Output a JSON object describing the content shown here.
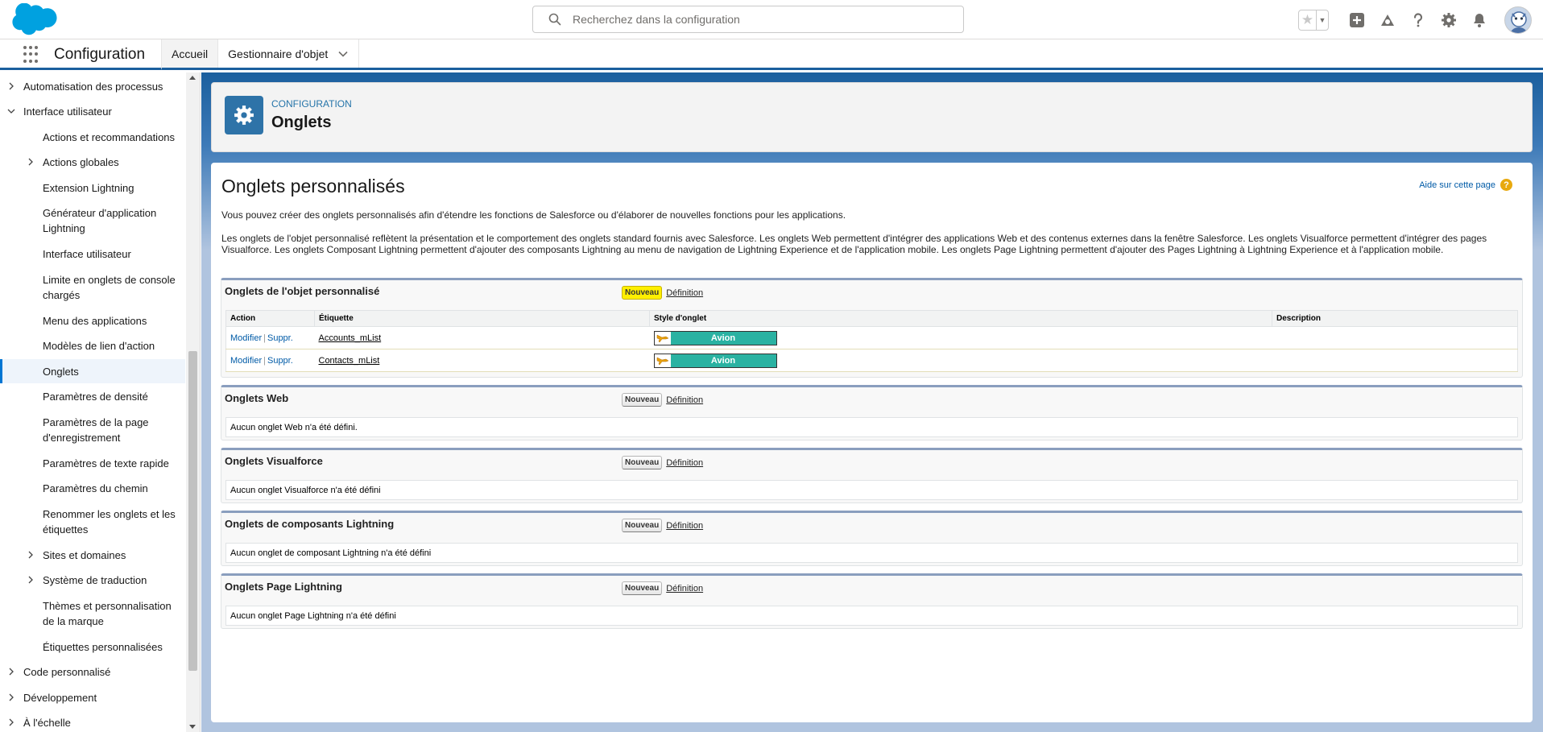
{
  "header": {
    "search_placeholder": "Recherchez dans la configuration"
  },
  "app_nav": {
    "app_name": "Configuration",
    "tabs": [
      {
        "label": "Accueil"
      },
      {
        "label": "Gestionnaire d'objet"
      }
    ]
  },
  "sidebar": {
    "items": [
      {
        "label": "Automatisation des processus"
      },
      {
        "label": "Interface utilisateur"
      },
      {
        "label": "Actions et recommandations"
      },
      {
        "label": "Actions globales"
      },
      {
        "label": "Extension Lightning"
      },
      {
        "label": "Générateur d'application Lightning"
      },
      {
        "label": "Interface utilisateur"
      },
      {
        "label": "Limite en onglets de console chargés"
      },
      {
        "label": "Menu des applications"
      },
      {
        "label": "Modèles de lien d'action"
      },
      {
        "label": "Onglets"
      },
      {
        "label": "Paramètres de densité"
      },
      {
        "label": "Paramètres de la page d'enregistrement"
      },
      {
        "label": "Paramètres de texte rapide"
      },
      {
        "label": "Paramètres du chemin"
      },
      {
        "label": "Renommer les onglets et les étiquettes"
      },
      {
        "label": "Sites et domaines"
      },
      {
        "label": "Système de traduction"
      },
      {
        "label": "Thèmes et personnalisation de la marque"
      },
      {
        "label": "Étiquettes personnalisées"
      },
      {
        "label": "Code personnalisé"
      },
      {
        "label": "Développement"
      },
      {
        "label": "À l'échelle"
      }
    ]
  },
  "page_header": {
    "kicker": "CONFIGURATION",
    "title": "Onglets"
  },
  "content": {
    "title": "Onglets personnalisés",
    "help_link": "Aide sur cette page",
    "para1": "Vous pouvez créer des onglets personnalisés afin d'étendre les fonctions de Salesforce ou d'élaborer de nouvelles fonctions pour les applications.",
    "para2": "Les onglets de l'objet personnalisé reflètent la présentation et le comportement des onglets standard fournis avec Salesforce. Les onglets Web permettent d'intégrer des applications Web et des contenus externes dans la fenêtre Salesforce. Les onglets Visualforce permettent d'intégrer des pages Visualforce. Les onglets Composant Lightning permettent d'ajouter des composants Lightning au menu de navigation de Lightning Experience et de l'application mobile. Les onglets Page Lightning permettent d'ajouter des Pages Lightning à Lightning Experience et à l'application mobile."
  },
  "sections": {
    "object": {
      "title": "Onglets de l'objet personnalisé",
      "new_label": "Nouveau",
      "def_label": "Définition",
      "columns": [
        "Action",
        "Étiquette",
        "Style d'onglet",
        "Description"
      ],
      "rows": [
        {
          "edit": "Modifier",
          "sep": "|",
          "del": "Suppr.",
          "label": "Accounts_mList",
          "style": "Avion",
          "description": ""
        },
        {
          "edit": "Modifier",
          "sep": "|",
          "del": "Suppr.",
          "label": "Contacts_mList",
          "style": "Avion",
          "description": ""
        }
      ]
    },
    "web": {
      "title": "Onglets Web",
      "new_label": "Nouveau",
      "def_label": "Définition",
      "empty": "Aucun onglet Web n'a été défini."
    },
    "visualforce": {
      "title": "Onglets Visualforce",
      "new_label": "Nouveau",
      "def_label": "Définition",
      "empty": "Aucun onglet Visualforce n'a été défini"
    },
    "lightning_comp": {
      "title": "Onglets de composants Lightning",
      "new_label": "Nouveau",
      "def_label": "Définition",
      "empty": "Aucun onglet de composant Lightning n'a été défini"
    },
    "lightning_page": {
      "title": "Onglets Page Lightning",
      "new_label": "Nouveau",
      "def_label": "Définition",
      "empty": "Aucun onglet Page Lightning n'a été défini"
    }
  },
  "colors": {
    "brand": "#1b5f9e",
    "accent": "#0176d3",
    "tab_style_avion": "#2ab2a2",
    "highlight_button": "#ffef00"
  }
}
